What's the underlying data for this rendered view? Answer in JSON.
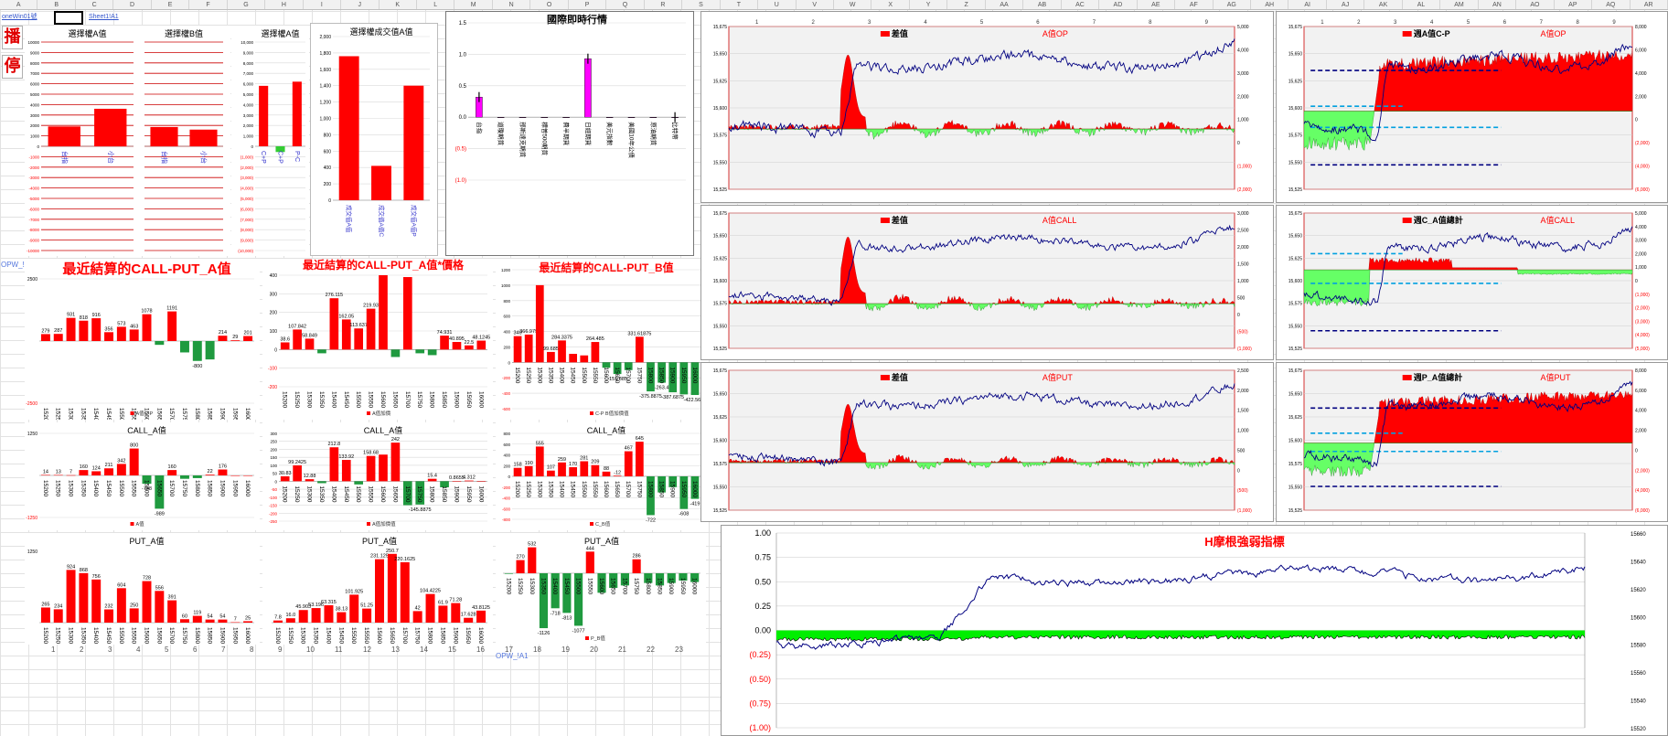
{
  "toolbar": {
    "broadcast_label": "播",
    "stop_label": "停",
    "links": [
      "oneWin01號",
      "Sheet1!A1"
    ]
  },
  "column_headers": [
    "A",
    "B",
    "C",
    "D",
    "E",
    "F",
    "G",
    "H",
    "I",
    "J",
    "K",
    "L",
    "M",
    "N",
    "O",
    "P",
    "Q",
    "R",
    "S",
    "T",
    "U",
    "V",
    "W",
    "X",
    "Y",
    "Z",
    "AA",
    "AB",
    "AC",
    "AD",
    "AE",
    "AF",
    "AG",
    "AH",
    "AI",
    "AJ",
    "AK",
    "AL",
    "AM",
    "AN",
    "AO",
    "AP",
    "AQ",
    "AR"
  ],
  "sheet_links": [
    "OPW_!A1",
    "OPW_!A1"
  ],
  "bottom_row_numbers": [
    "1",
    "2",
    "3",
    "4",
    "5",
    "6",
    "7",
    "8",
    "9",
    "10",
    "11",
    "12",
    "13",
    "14",
    "15",
    "16",
    "17",
    "18",
    "19",
    "20",
    "21",
    "22",
    "23"
  ],
  "colors": {
    "red": "#ff0000",
    "dark_red": "#cc0000",
    "green": "#33cc33",
    "light_green": "#66ff66",
    "dark_green": "#1f9a3f",
    "navy": "#000080",
    "magenta": "#ff00ff",
    "panel_bg": "#f2f2f2",
    "grid": "#bfbfbf"
  },
  "charts": {
    "mini_a": {
      "title": "選擇權A值",
      "y_ticks": [
        "10000",
        "9000",
        "8000",
        "7000",
        "6000",
        "5000",
        "4000",
        "3000",
        "2000",
        "1000",
        "0",
        "-1000",
        "-2000",
        "-3000",
        "-4000",
        "-5000",
        "-6000",
        "-7000",
        "-8000",
        "-9000",
        "-10000"
      ],
      "categories": [
        "台指",
        "小台"
      ],
      "values": [
        1900,
        3600
      ],
      "ylim": [
        -10000,
        10000
      ]
    },
    "mini_b": {
      "title": "選擇權B值",
      "categories": [
        "台指",
        "小台"
      ],
      "values": [
        1850,
        1600
      ]
    },
    "mini_ac": {
      "title": "選擇權A值",
      "y_ticks": [
        "10,000",
        "9,000",
        "8,000",
        "7,000",
        "6,000",
        "5,000",
        "4,000",
        "3,000",
        "2,000",
        "1,000",
        "0",
        "(1,000)",
        "(2,000)",
        "(3,000)",
        "(4,000)",
        "(5,000)",
        "(6,000)",
        "(7,000)",
        "(8,000)",
        "(9,000)",
        "(10,000)"
      ],
      "categories": [
        "C+P",
        "C+P",
        "P-C"
      ],
      "values": [
        5800,
        -550,
        6200
      ],
      "ylim": [
        -10000,
        10000
      ]
    },
    "trade_a": {
      "title": "選擇權成交值A值",
      "y_ticks": [
        "2,000",
        "1,800",
        "1,600",
        "1,400",
        "1,200",
        "1,000",
        "800",
        "600",
        "400",
        "200",
        "0"
      ],
      "categories": [
        "成交值A值",
        "成交值A值C",
        "成交值A值P"
      ],
      "values": [
        1760,
        420,
        1400
      ],
      "ylim": [
        0,
        2000
      ]
    },
    "intl": {
      "title": "國際即時行情",
      "y_ticks": [
        "1.5",
        "1.0",
        "0.5",
        "0.0",
        "(0.5)",
        "(1.0)"
      ],
      "categories": [
        "台指",
        "道瓊期貨",
        "那斯達克期貨",
        "標普500期貨",
        "費半期貨",
        "日經期貨",
        "美元指數",
        "美國10年公債",
        "原油期貨",
        "比特幣"
      ],
      "values": [
        0.32,
        0,
        0,
        0,
        0,
        0.93,
        0,
        0,
        0,
        0
      ],
      "ylim": [
        -1.0,
        1.5
      ]
    },
    "settle_cp_a": {
      "title": "最近結算的CALL-PUT_A值",
      "y_ticks": [
        "2500",
        "-2500"
      ],
      "categories": [
        "15200",
        "15250",
        "15300",
        "15350",
        "15400",
        "15450",
        "15500",
        "15550",
        "15600",
        "15650",
        "15700",
        "15750",
        "15800",
        "15850",
        "15900",
        "15950",
        "16000"
      ],
      "values": [
        279,
        287,
        931,
        818,
        916,
        356,
        573,
        463,
        1078,
        -153,
        1191,
        -458,
        -800,
        -740,
        214,
        29,
        201
      ],
      "value_labels": [
        "279",
        "287",
        "931",
        "818",
        "916",
        "356",
        "573",
        "463",
        "1078",
        "",
        "1191",
        "",
        "-800",
        "",
        "214",
        "29",
        "201"
      ],
      "ylim": [
        -2500,
        2500
      ],
      "legend": "A值C-P"
    },
    "settle_cp_a_price": {
      "title": "最近結算的CALL-PUT_A值*價格",
      "y_ticks": [
        "400",
        "300",
        "200",
        "100",
        "0",
        "-100",
        "-200"
      ],
      "categories": [
        "15200",
        "15250",
        "15300",
        "15350",
        "15400",
        "15450",
        "15500",
        "15550",
        "15600",
        "15650",
        "15700",
        "15750",
        "15800",
        "15850",
        "15900",
        "15950",
        "16000"
      ],
      "values": [
        38.6,
        107.8,
        58.8,
        -20,
        276.1,
        162,
        113.6,
        219.9,
        400,
        -40,
        390,
        -20,
        -30,
        74.9,
        40.9,
        22.5,
        48.1
      ],
      "value_labels": [
        "38.6",
        "107.842",
        "58.849",
        "",
        "276.115",
        "162.05",
        "113.637",
        "219.93",
        "",
        "",
        "",
        "",
        "",
        "74.931",
        "40.895",
        "22.5",
        "48.1245"
      ],
      "ylim": [
        -200,
        400
      ],
      "legend": "A值加價"
    },
    "settle_cp_b": {
      "title": "最近結算的CALL-PUT_B值",
      "y_ticks": [
        "1200",
        "1000",
        "800",
        "600",
        "400",
        "200",
        "0",
        "-200",
        "-400",
        "-600"
      ],
      "categories": [
        "15200",
        "15250",
        "15300",
        "15350",
        "15400",
        "15450",
        "15500",
        "15550",
        "15600",
        "15650",
        "15700",
        "15750",
        "15800",
        "15850",
        "15900",
        "15950",
        "16000"
      ],
      "values": [
        340,
        360,
        1000,
        135,
        284,
        110,
        90,
        264,
        -70,
        -151,
        -100,
        331.6,
        -375.9,
        -263.4,
        -387,
        -415,
        -422.5
      ],
      "value_labels": [
        "340",
        "366.979",
        "",
        "99.685",
        "284.3375",
        "",
        "",
        "264.485",
        "",
        "-151.885",
        "",
        "331.61875",
        "-375.8875",
        "-263.4",
        "-387.6875",
        "",
        "-422.5688"
      ],
      "ylim": [
        -600,
        1200
      ],
      "legend": "C-P B值加價值"
    },
    "call_a": {
      "title": "CALL_A值",
      "y_ticks": [
        "1250",
        "-1250"
      ],
      "categories": [
        "15200",
        "15250",
        "15300",
        "15350",
        "15400",
        "15450",
        "15500",
        "15550",
        "15600",
        "15650",
        "15700",
        "15750",
        "15800",
        "15850",
        "15900",
        "15950",
        "16000"
      ],
      "values": [
        14,
        13,
        7,
        160,
        124,
        211,
        342,
        800,
        -248,
        -989,
        160,
        -100,
        -80,
        22,
        176,
        0,
        0
      ],
      "value_labels": [
        "14",
        "13",
        "7",
        "160",
        "124",
        "211",
        "342",
        "800",
        "-748",
        "-989",
        "160",
        "",
        "",
        "22",
        "176",
        "",
        ""
      ],
      "ylim": [
        -1250,
        1250
      ],
      "legend": "A值"
    },
    "call_a_price": {
      "title": "CALL_A值",
      "y_ticks": [
        "300",
        "250",
        "200",
        "150",
        "100",
        "50",
        "0",
        "-50",
        "-100",
        "-150",
        "-200",
        "-250"
      ],
      "categories": [
        "15200",
        "15250",
        "15300",
        "15350",
        "15400",
        "15450",
        "15500",
        "15550",
        "15600",
        "15650",
        "15700",
        "15750",
        "15800",
        "15850",
        "15900",
        "15950",
        "16000"
      ],
      "values": [
        30.8,
        99.2,
        12.8,
        -12,
        212.8,
        133.9,
        -20,
        158.6,
        167,
        242,
        -150,
        -145.9,
        15.4,
        -38,
        0.8,
        4.3,
        0
      ],
      "value_labels": [
        "30.83",
        "99.2425",
        "12.88",
        "",
        "212.8",
        "133.92",
        "",
        "158.68",
        "",
        "242",
        "",
        "-145.8875",
        "15.4",
        "",
        "0.8655",
        "4.312",
        ""
      ],
      "ylim": [
        -250,
        300
      ],
      "legend": "A值加價值"
    },
    "call_b": {
      "title": "CALL_A值",
      "y_ticks": [
        "800",
        "600",
        "400",
        "200",
        "0",
        "-200",
        "-400",
        "-600",
        "-800"
      ],
      "categories": [
        "15200",
        "15250",
        "15300",
        "15350",
        "15400",
        "15450",
        "15500",
        "15550",
        "15600",
        "15650",
        "15700",
        "15750",
        "15800",
        "15850",
        "15900",
        "15950",
        "16000"
      ],
      "values": [
        158,
        190,
        555,
        107,
        259,
        170,
        281,
        209,
        88,
        12,
        467,
        645,
        -722,
        -300,
        -200,
        -608,
        -419
      ],
      "value_labels": [
        "158",
        "190",
        "555",
        "107",
        "259",
        "170",
        "281",
        "209",
        "88",
        "-12",
        "467",
        "645",
        "-722",
        "",
        "",
        "-608",
        "-419"
      ],
      "ylim": [
        -800,
        800
      ],
      "legend": "C_B值"
    },
    "put_a": {
      "title": "PUT_A值",
      "y_ticks": [
        "1250"
      ],
      "categories": [
        "15200",
        "15250",
        "15300",
        "15350",
        "15400",
        "15450",
        "15500",
        "15550",
        "15600",
        "15650",
        "15700",
        "15750",
        "15800",
        "15850",
        "15900",
        "15950",
        "16000"
      ],
      "values": [
        265,
        234,
        924,
        868,
        756,
        232,
        604,
        250,
        728,
        556,
        391,
        60,
        119,
        54,
        54,
        7,
        25
      ],
      "value_labels": [
        "265",
        "234",
        "924",
        "868",
        "756",
        "232",
        "604",
        "250",
        "728",
        "556",
        "391",
        "60",
        "119",
        "54",
        "54",
        "7",
        "25"
      ],
      "ylim": [
        0,
        1250
      ]
    },
    "put_a_price": {
      "title": "PUT_A值",
      "categories": [
        "15200",
        "15250",
        "15300",
        "15350",
        "15400",
        "15450",
        "15500",
        "15550",
        "15600",
        "15650",
        "15700",
        "15750",
        "15800",
        "15850",
        "15900",
        "15950",
        "16000"
      ],
      "values": [
        7.8,
        16,
        45.9,
        53.1,
        63.3,
        38.1,
        101.9,
        51.3,
        231.2,
        250.7,
        220.2,
        42,
        104.4,
        61.9,
        71.3,
        17.6,
        43.8
      ],
      "value_labels": [
        "7.8",
        "16.0",
        "45.903",
        "53.196",
        "63.315",
        "38.13",
        "101.925",
        "51.25",
        "231.125",
        "250.7",
        "220.1625",
        "42",
        "104.4225",
        "61.9",
        "71.28",
        "17.628",
        "43.8125"
      ],
      "ylim": [
        0,
        280
      ]
    },
    "put_b": {
      "title": "PUT_A值",
      "categories": [
        "15200",
        "15250",
        "15300",
        "15350",
        "15400",
        "15450",
        "15500",
        "15550",
        "15600",
        "15650",
        "15700",
        "15750",
        "15800",
        "15850",
        "15900",
        "15950",
        "16000"
      ],
      "values": [
        -12,
        270,
        532,
        -1126,
        -718,
        -813,
        -1077,
        444,
        -400,
        -300,
        -250,
        286,
        -200,
        -250,
        -200,
        -150,
        -180
      ],
      "value_labels": [
        "",
        "270",
        "532",
        "-1126",
        "-718",
        "-813",
        "-1077",
        "444",
        "",
        "",
        "",
        "286",
        "",
        "",
        "",
        "",
        ""
      ],
      "ylim": [
        -1200,
        600
      ],
      "legend": "P_B值"
    },
    "big_op": {
      "legend": "差值",
      "label": "A值OP",
      "left_ticks": [
        "15,675",
        "15,650",
        "15,625",
        "15,600",
        "15,575",
        "15,550",
        "15,525"
      ],
      "right_ticks": [
        "5,000",
        "4,000",
        "3,000",
        "2,000",
        "1,000",
        "0",
        "(1,000)",
        "(2,000)"
      ],
      "x_ticks": [
        "1",
        "2",
        "3",
        "4",
        "5",
        "6",
        "7",
        "8",
        "9"
      ]
    },
    "big_call": {
      "legend": "差值",
      "label": "A值CALL",
      "left_ticks": [
        "15,675",
        "15,650",
        "15,625",
        "15,600",
        "15,575",
        "15,550",
        "15,525"
      ],
      "right_ticks": [
        "3,000",
        "2,500",
        "2,000",
        "1,500",
        "1,000",
        "500",
        "0",
        "(500)",
        "(1,000)"
      ]
    },
    "big_put": {
      "legend": "差值",
      "label": "A值PUT",
      "left_ticks": [
        "15,675",
        "15,650",
        "15,625",
        "15,600",
        "15,575",
        "15,550",
        "15,525"
      ],
      "right_ticks": [
        "2,500",
        "2,000",
        "1,500",
        "1,000",
        "500",
        "0",
        "(500)",
        "(1,000)"
      ]
    },
    "week_cp": {
      "legend": "週A值C-P",
      "label": "A值OP",
      "left_ticks": [
        "15,675",
        "15,650",
        "15,625",
        "15,600",
        "15,575",
        "15,550",
        "15,525"
      ],
      "right_ticks": [
        "8,000",
        "6,000",
        "4,000",
        "2,000",
        "0",
        "(2,000)",
        "(4,000)",
        "(6,000)"
      ],
      "x_ticks": [
        "1",
        "2",
        "3",
        "4",
        "5",
        "6",
        "7",
        "8",
        "9"
      ]
    },
    "week_c": {
      "legend": "週C_A值總計",
      "label": "A值CALL",
      "left_ticks": [
        "15,675",
        "15,650",
        "15,625",
        "15,600",
        "15,575",
        "15,550",
        "15,525"
      ],
      "right_ticks": [
        "5,000",
        "4,000",
        "3,000",
        "2,000",
        "1,000",
        "0",
        "(1,000)",
        "(2,000)",
        "(3,000)",
        "(4,000)",
        "(5,000)"
      ]
    },
    "week_p": {
      "legend": "週P_A值總計",
      "label": "A值PUT",
      "left_ticks": [
        "15,675",
        "15,650",
        "15,625",
        "15,600",
        "15,575",
        "15,550",
        "15,525"
      ],
      "right_ticks": [
        "8,000",
        "6,000",
        "4,000",
        "2,000",
        "0",
        "(2,000)",
        "(4,000)",
        "(6,000)"
      ]
    },
    "morgan": {
      "title": "H摩根強弱指標",
      "left_ticks": [
        "1.00",
        "0.75",
        "0.50",
        "0.25",
        "0.00",
        "(0.25)",
        "(0.50)",
        "(0.75)",
        "(1.00)"
      ],
      "right_ticks": [
        "15660",
        "15640",
        "15620",
        "15600",
        "15580",
        "15560",
        "15540",
        "15520"
      ]
    }
  }
}
